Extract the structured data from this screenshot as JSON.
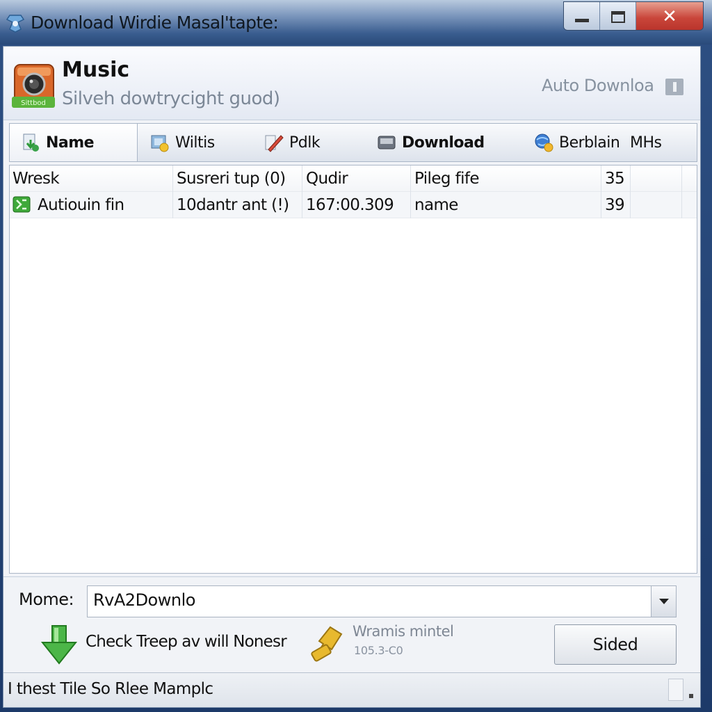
{
  "window": {
    "title": "Download Wirdie Masal'tapte:",
    "controls": {
      "minimize": "minimize",
      "maximize": "maximize",
      "close": "✕"
    }
  },
  "header": {
    "icon_badge": "Sittbod",
    "title": "Music",
    "subtitle": "Silveh dowtrycight guod)",
    "auto_download": "Auto Downloa"
  },
  "tabs": [
    {
      "label": "Name",
      "icon": "download-page-icon",
      "active": true
    },
    {
      "label": "Wiltis",
      "icon": "media-icon",
      "active": false
    },
    {
      "label": "Pdlk",
      "icon": "pencil-icon",
      "active": false
    },
    {
      "label": "Download",
      "icon": "drive-icon",
      "active": false
    },
    {
      "label": "Berblain",
      "icon": "globe-icon",
      "active": false
    },
    {
      "label": "MHs",
      "icon": "",
      "active": false
    }
  ],
  "list": {
    "rows": [
      {
        "icon": "",
        "name": "Wresk",
        "status": "Susreri tup (0)",
        "quality": "Qudir",
        "file": "Pileg fife",
        "count": "35"
      },
      {
        "icon": "green-file-icon",
        "name": "Autiouin fin",
        "status": "10dantr ant (!)",
        "quality": "167:00.309",
        "file": "name",
        "count": "39"
      }
    ]
  },
  "bottom": {
    "name_label": "Mome:",
    "name_value": "RvA2Downlo",
    "check_text": "Check Treep av will Nonesr",
    "warn_title": "Wramis mintel",
    "warn_sub": "105.3-C0",
    "sided_button": "Sided"
  },
  "status": {
    "text": "I thest Tile So Rlee Mamplc"
  }
}
